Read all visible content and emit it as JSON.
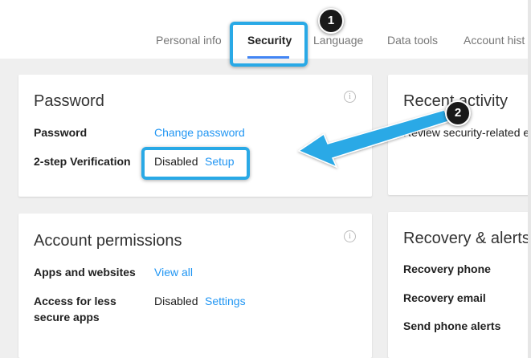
{
  "tabs": [
    {
      "label": "Personal info",
      "active": false
    },
    {
      "label": "Security",
      "active": true
    },
    {
      "label": "Language",
      "active": false
    },
    {
      "label": "Data tools",
      "active": false
    },
    {
      "label": "Account hist",
      "active": false
    }
  ],
  "password_card": {
    "title": "Password",
    "info_icon": "i",
    "rows": [
      {
        "label": "Password",
        "value": "",
        "link": "Change password"
      },
      {
        "label": "2-step Verification",
        "value": "Disabled",
        "link": "Setup"
      }
    ]
  },
  "recent_activity_card": {
    "title": "Recent activity",
    "text": "Review security-related e"
  },
  "permissions_card": {
    "title": "Account permissions",
    "info_icon": "i",
    "rows": [
      {
        "label": "Apps and websites",
        "value": "",
        "link": "View all"
      },
      {
        "label_line1": "Access for less",
        "label_line2": "secure apps",
        "value": "Disabled",
        "link": "Settings"
      }
    ]
  },
  "recovery_card": {
    "title": "Recovery & alerts",
    "rows": [
      {
        "label": "Recovery phone"
      },
      {
        "label": "Recovery email"
      },
      {
        "label": "Send phone alerts"
      }
    ]
  },
  "annotations": {
    "badge_1": "1",
    "badge_2": "2",
    "highlight_color": "#29a9e6",
    "arrow_color": "#29a9e6"
  },
  "colors": {
    "link": "#2196f3",
    "accent_underline": "#4285f4",
    "background": "#efefef"
  }
}
